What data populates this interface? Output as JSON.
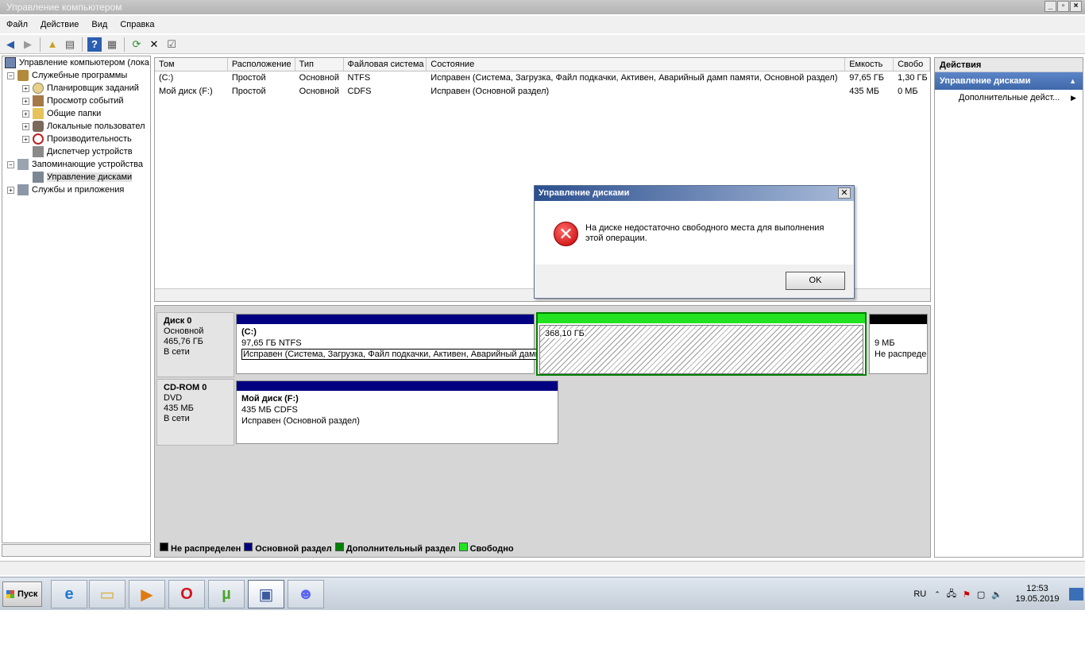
{
  "window": {
    "title": "Управление компьютером",
    "btn_min": "_",
    "btn_max": "▫",
    "btn_close": "×"
  },
  "menu": [
    "Файл",
    "Действие",
    "Вид",
    "Справка"
  ],
  "tree": {
    "root": "Управление компьютером (лока",
    "items": [
      {
        "label": "Служебные программы",
        "level": 1,
        "exp": "−"
      },
      {
        "label": "Планировщик заданий",
        "level": 2,
        "exp": "+"
      },
      {
        "label": "Просмотр событий",
        "level": 2,
        "exp": "+"
      },
      {
        "label": "Общие папки",
        "level": 2,
        "exp": "+"
      },
      {
        "label": "Локальные пользовател",
        "level": 2,
        "exp": "+"
      },
      {
        "label": "Производительность",
        "level": 2,
        "exp": "+"
      },
      {
        "label": "Диспетчер устройств",
        "level": 2,
        "exp": ""
      },
      {
        "label": "Запоминающие устройства",
        "level": 1,
        "exp": "−"
      },
      {
        "label": "Управление дисками",
        "level": 2,
        "exp": "",
        "selected": true
      },
      {
        "label": "Службы и приложения",
        "level": 1,
        "exp": "+"
      }
    ]
  },
  "volumes": {
    "headers": [
      "Том",
      "Расположение",
      "Тип",
      "Файловая система",
      "Состояние",
      "Емкость",
      "Свобо"
    ],
    "rows": [
      [
        "(C:)",
        "Простой",
        "Основной",
        "NTFS",
        "Исправен (Система, Загрузка, Файл подкачки, Активен, Аварийный дамп памяти, Основной раздел)",
        "97,65 ГБ",
        "1,30 ГБ"
      ],
      [
        "Мой диск (F:)",
        "Простой",
        "Основной",
        "CDFS",
        "Исправен (Основной раздел)",
        "435 МБ",
        "0 МБ"
      ]
    ]
  },
  "disks": {
    "disk0": {
      "name": "Диск 0",
      "type": "Основной",
      "size": "465,76 ГБ",
      "status": "В сети",
      "p1": {
        "name": "(C:)",
        "size": "97,65 ГБ NTFS",
        "status": "Исправен (Система, Загрузка, Файл подкачки, Активен, Аварийный дамп памяти, Основной раздел)"
      },
      "p2": {
        "size": "368,10 ГБ"
      },
      "p3": {
        "size": "9 МБ",
        "status": "Не распреде"
      }
    },
    "cdrom": {
      "name": "CD-ROM 0",
      "type": "DVD",
      "size": "435 МБ",
      "status": "В сети",
      "p1": {
        "name": "Мой диск  (F:)",
        "size": "435 МБ CDFS",
        "status": "Исправен (Основной раздел)"
      }
    }
  },
  "legend": [
    {
      "label": "Не распределен",
      "color": "#000000"
    },
    {
      "label": "Основной раздел",
      "color": "#000080"
    },
    {
      "label": "Дополнительный раздел",
      "color": "#008000"
    },
    {
      "label": "Свободно",
      "color": "#21e321"
    }
  ],
  "actions": {
    "title": "Действия",
    "section": "Управление дисками",
    "more": "Дополнительные дейст..."
  },
  "dialog": {
    "title": "Управление дисками",
    "message": "На диске недостаточно свободного места для выполнения этой операции.",
    "ok": "OK"
  },
  "taskbar": {
    "start": "Пуск",
    "lang": "RU",
    "time": "12:53",
    "date": "19.05.2019"
  },
  "colors": {
    "primary": "#000080",
    "free": "#21e321",
    "extended": "#008000",
    "error": "#c40000"
  }
}
